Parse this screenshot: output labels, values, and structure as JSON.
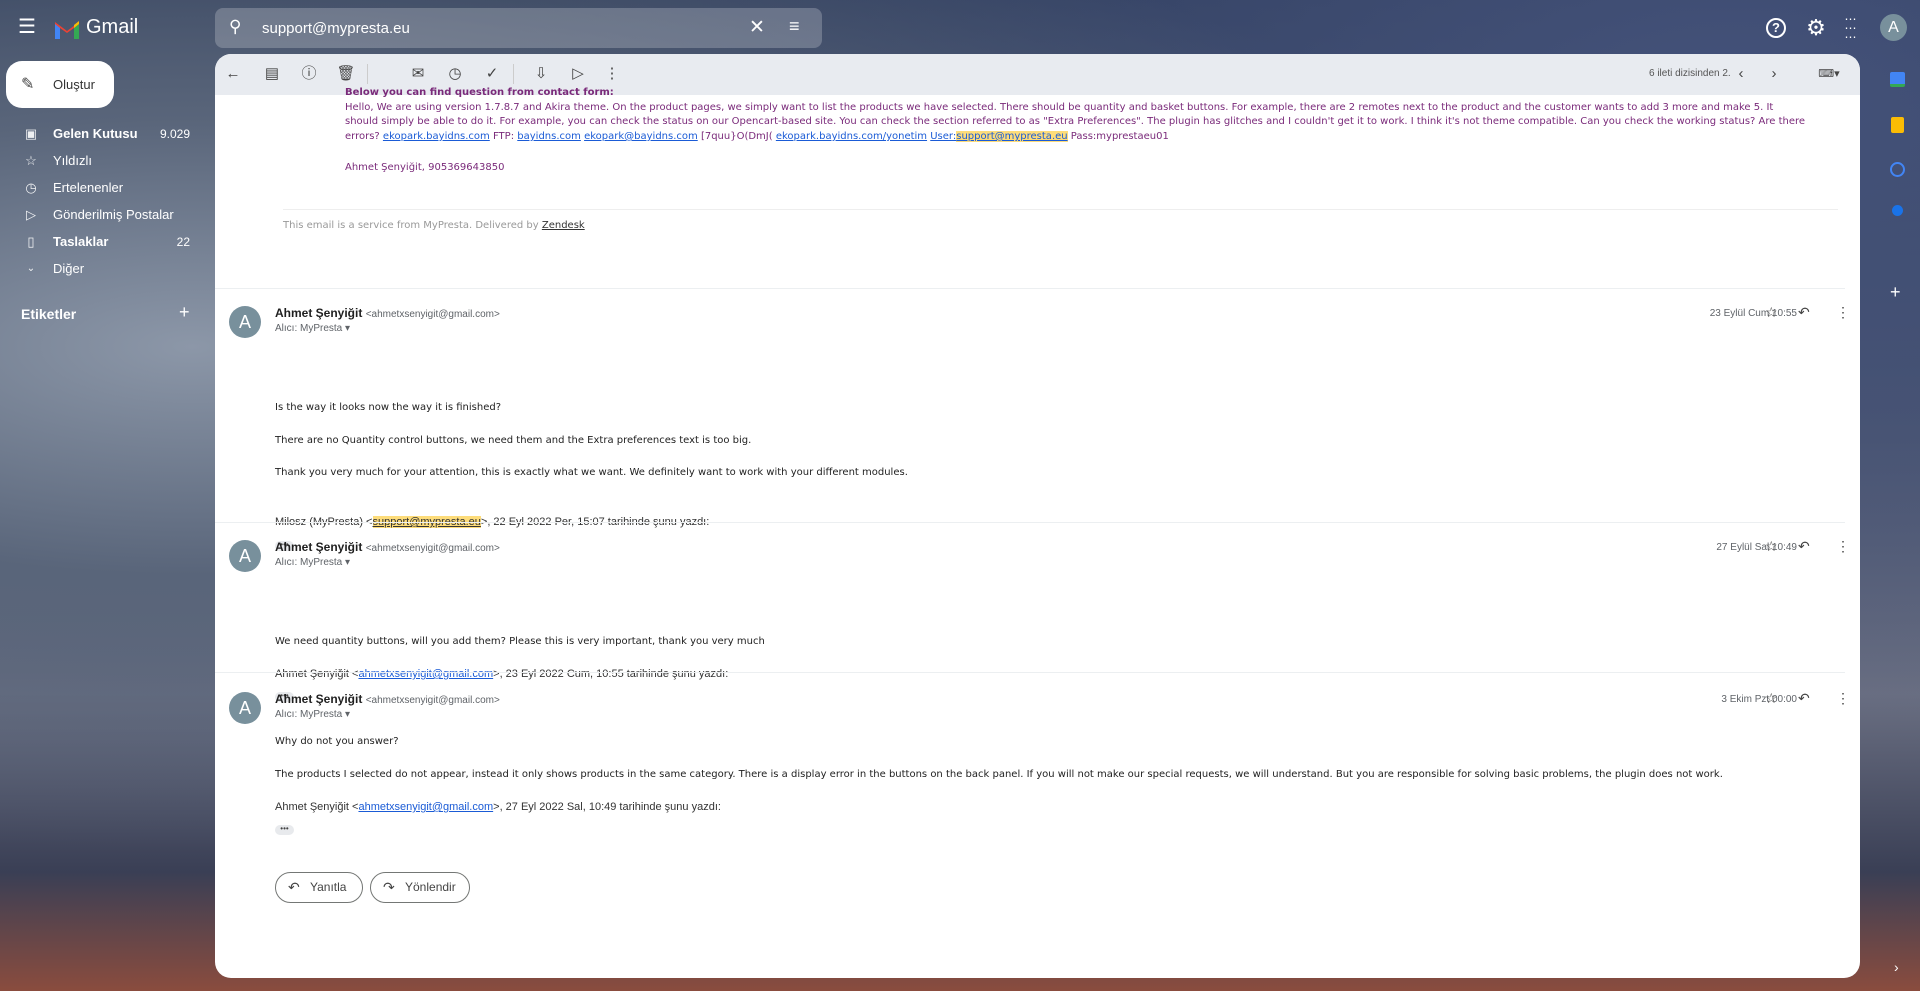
{
  "app": {
    "name": "Gmail"
  },
  "search": {
    "value": "support@mypresta.eu"
  },
  "compose": {
    "label": "Oluştur"
  },
  "sidebar": {
    "items": [
      {
        "label": "Gelen Kutusu",
        "count": "9.029",
        "icon": "inbox-icon",
        "bold": true
      },
      {
        "label": "Yıldızlı",
        "icon": "star-icon"
      },
      {
        "label": "Ertelenenler",
        "icon": "clock-icon"
      },
      {
        "label": "Gönderilmiş Postalar",
        "icon": "send-icon"
      },
      {
        "label": "Taslaklar",
        "count": "22",
        "icon": "draft-icon",
        "bold": true
      },
      {
        "label": "Diğer",
        "icon": "chevron-down-icon"
      }
    ],
    "labels_title": "Etiketler"
  },
  "avatar": {
    "letter": "A"
  },
  "toolbar": {
    "pagination": "6 ileti dizisinden 2."
  },
  "thread": {
    "first": {
      "heading": "Below you can find question from contact form:",
      "line1": "Hello, We are using version 1.7.8.7 and Akira theme. On the product pages, we simply want to list the products we have selected. There should be quantity and basket buttons. For example, there are 2 remotes next to the product and the customer wants to add 3 more and make 5. It",
      "line2": "should simply be able to do it. For example, you can check the status on our Opencart-based site. You can check the section referred to as \"Extra Preferences\". The plugin has glitches and I couldn't get it to work. I think it's not theme compatible. Can you check the working status? Are there",
      "line3_prefix": "errors?",
      "link1": "ekopark.bayidns.com",
      "ftp": "FTP:",
      "link2": "bayidns.com",
      "link3": "ekopark@bayidns.com",
      "code": "[7quu}O(DmJ(",
      "link4": "ekopark.bayidns.com/yonetim",
      "user_label": "User:",
      "user_email": "support@mypresta.eu",
      "pass": "Pass:myprestaeu01",
      "signature": "Ahmet Şenyiğit, 905369643850",
      "footer_text": "This email is a service from MyPresta. Delivered by",
      "footer_link": "Zendesk"
    },
    "messages": [
      {
        "sender": "Ahmet Şenyiğit",
        "email": "<ahmetxsenyigit@gmail.com>",
        "to": "Alıcı: MyPresta",
        "date": "23 Eylül Cum 10:55",
        "lines": [
          "Is the way it looks now the way it is finished?",
          "There are no Quantity control buttons, we need them and the Extra preferences text is too big.",
          "Thank you very much for your attention, this is exactly what we want. We definitely want to work with your different modules."
        ],
        "quote_pre": "Milosz (MyPresta) <",
        "quote_email": "support@mypresta.eu",
        "quote_post": ">, 22 Eyl 2022 Per, 15:07 tarihinde şunu yazdı:"
      },
      {
        "sender": "Ahmet Şenyiğit",
        "email": "<ahmetxsenyigit@gmail.com>",
        "to": "Alıcı: MyPresta",
        "date": "27 Eylül Sal 10:49",
        "lines": [
          "We need quantity buttons, will you add them? Please this is very important, thank you very much"
        ],
        "quote_pre": "Ahmet Şenyiğit <",
        "quote_email": "ahmetxsenyigit@gmail.com",
        "quote_post": ">, 23 Eyl 2022 Cum, 10:55 tarihinde şunu yazdı:"
      },
      {
        "sender": "Ahmet Şenyiğit",
        "email": "<ahmetxsenyigit@gmail.com>",
        "to": "Alıcı: MyPresta",
        "date": "3 Ekim Pzt 00:00",
        "lines": [
          "Why do not you answer?",
          "The products I selected do not appear, instead it only shows products in the same category. There is a display error in the buttons on the back panel. If you will not make our special requests, we will understand. But you are responsible for solving basic problems, the plugin does not work."
        ],
        "quote_pre": "Ahmet Şenyiğit <",
        "quote_email": "ahmetxsenyigit@gmail.com",
        "quote_post": ">, 27 Eyl 2022 Sal, 10:49 tarihinde şunu yazdı:"
      }
    ],
    "reply_label": "Yanıtla",
    "forward_label": "Yönlendir",
    "ellipsis": "•••"
  }
}
